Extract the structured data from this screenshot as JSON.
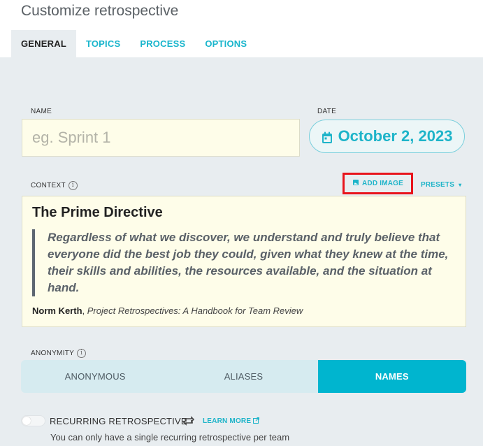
{
  "header": {
    "title": "Customize retrospective",
    "tabs": [
      {
        "label": "GENERAL",
        "active": true
      },
      {
        "label": "TOPICS",
        "active": false
      },
      {
        "label": "PROCESS",
        "active": false
      },
      {
        "label": "OPTIONS",
        "active": false
      }
    ]
  },
  "form": {
    "name_label": "NAME",
    "name_placeholder": "eg. Sprint 1",
    "date_label": "DATE",
    "date_value": "October 2, 2023",
    "context_label": "CONTEXT",
    "add_image_label": "ADD IMAGE",
    "presets_label": "PRESETS",
    "context": {
      "heading": "The Prime Directive",
      "quote": "Regardless of what we discover, we understand and truly believe that everyone did the best job they could, given what they knew at the time, their skills and abilities, the resources available, and the situation at hand.",
      "author": "Norm Kerth",
      "source": "Project Retrospectives: A Handbook for Team Review"
    },
    "anonymity_label": "ANONYMITY",
    "anonymity_options": [
      {
        "label": "ANONYMOUS",
        "active": false
      },
      {
        "label": "ALIASES",
        "active": false
      },
      {
        "label": "NAMES",
        "active": true
      }
    ],
    "recurring": {
      "label": "RECURRING RETROSPECTIVE",
      "learn_more": "LEARN MORE",
      "note": "You can only have a single recurring retrospective per team",
      "enabled": false
    }
  },
  "colors": {
    "accent": "#1eb4c9",
    "active_segment": "#00b5cf",
    "highlight_border": "#e8141c",
    "input_bg": "#fefde9"
  }
}
